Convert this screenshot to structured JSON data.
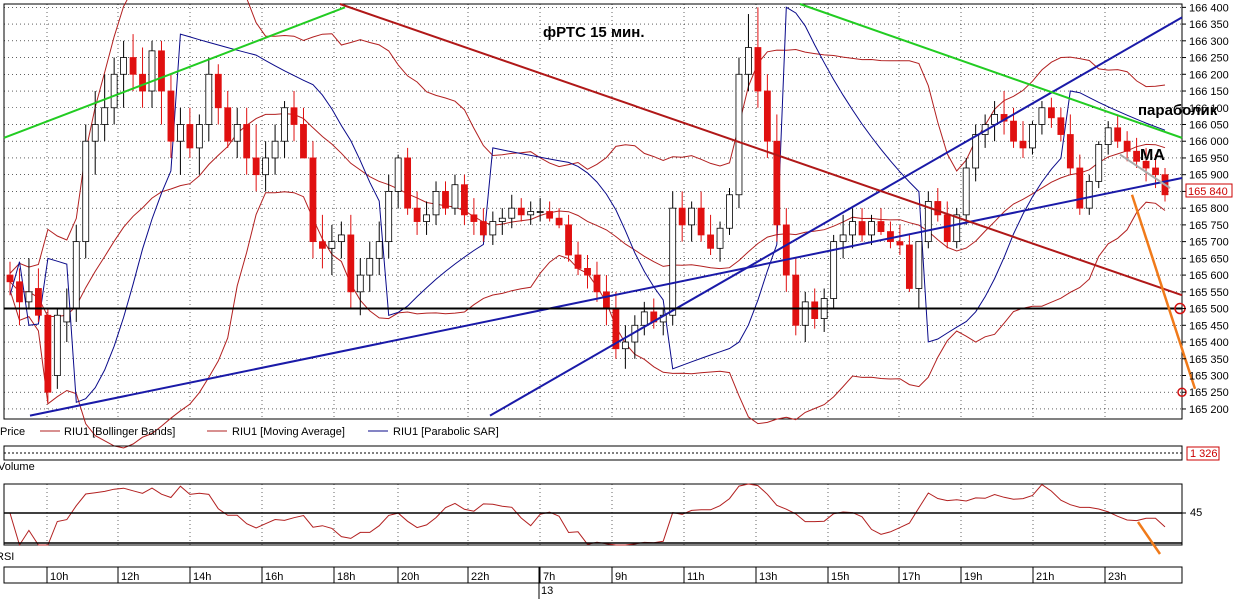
{
  "chart_data": {
    "type": "candlestick",
    "title": "фРТС   15 мин.",
    "colors": {
      "up_candle": "#ffffff",
      "down_candle": "#e01010",
      "bollinger": "#b22020",
      "moving_average": "#b22020",
      "parabolic_sar": "#0a0a8a",
      "channel": "#1a1aa8",
      "resistance_red": "#b01818",
      "green_lines": "#22cc22",
      "forecast": "#f07a1a",
      "grid": "#000000"
    },
    "price_axis": {
      "ticks": [
        166400,
        166350,
        166300,
        166250,
        166200,
        166150,
        166100,
        166050,
        166000,
        165950,
        165900,
        165850,
        165800,
        165750,
        165700,
        165650,
        165600,
        165550,
        165500,
        165450,
        165400,
        165350,
        165300,
        165250,
        165200
      ],
      "tick_labels": [
        "166 400",
        "166 350",
        "166 300",
        "166 250",
        "166 200",
        "166 150",
        "166 100",
        "166 050",
        "166 000",
        "165 950",
        "165 900",
        "165 850",
        "165 800",
        "165 750",
        "165 700",
        "165 650",
        "165 600",
        "165 550",
        "165 500",
        "165 450",
        "165 400",
        "165 350",
        "165 300",
        "165 250",
        "165 200"
      ],
      "ylim": [
        165170,
        166410
      ],
      "current_price_label": "165 840",
      "current_price": 165840
    },
    "legend": [
      {
        "label": "Price",
        "icon": "none"
      },
      {
        "label": "RIU1 [Bollinger Bands]",
        "icon": "red-line"
      },
      {
        "label": "RIU1 [Moving Average]",
        "icon": "red-line"
      },
      {
        "label": "RIU1 [Parabolic SAR]",
        "icon": "blue-line"
      }
    ],
    "annotations": [
      {
        "text": "параболик"
      },
      {
        "text": "МА"
      }
    ],
    "time_axis": {
      "labels": [
        "10h",
        "12h",
        "14h",
        "16h",
        "18h",
        "20h",
        "22h",
        "7h",
        "9h",
        "11h",
        "13h",
        "15h",
        "17h",
        "19h",
        "21h",
        "23h"
      ],
      "date_label": "13"
    },
    "volume_panel": {
      "title": "Volume",
      "value_label": "1 326"
    },
    "rsi_panel": {
      "title": "RSI",
      "level_label": "45",
      "ylim": [
        0,
        100
      ]
    },
    "candles": [
      [
        165600,
        165640,
        165540,
        165580
      ],
      [
        165580,
        165620,
        165450,
        165520
      ],
      [
        165520,
        165650,
        165500,
        165550
      ],
      [
        165560,
        165620,
        165460,
        165480
      ],
      [
        165480,
        165500,
        165220,
        165250
      ],
      [
        165300,
        165500,
        165260,
        165480
      ],
      [
        165460,
        165560,
        165400,
        165500
      ],
      [
        165500,
        165750,
        165460,
        165700
      ],
      [
        165700,
        166050,
        165650,
        166000
      ],
      [
        166000,
        166150,
        165900,
        166050
      ],
      [
        166050,
        166200,
        166000,
        166100
      ],
      [
        166100,
        166250,
        166050,
        166200
      ],
      [
        166200,
        166300,
        166100,
        166250
      ],
      [
        166250,
        166320,
        166150,
        166200
      ],
      [
        166200,
        166280,
        166100,
        166150
      ],
      [
        166150,
        166300,
        166100,
        166270
      ],
      [
        166270,
        166300,
        166050,
        166150
      ],
      [
        166150,
        166200,
        165950,
        166000
      ],
      [
        166000,
        166100,
        165900,
        166050
      ],
      [
        166050,
        166100,
        165950,
        165980
      ],
      [
        165980,
        166080,
        165900,
        166050
      ],
      [
        166050,
        166250,
        166000,
        166200
      ],
      [
        166200,
        166230,
        166050,
        166100
      ],
      [
        166100,
        166150,
        165980,
        166000
      ],
      [
        166000,
        166100,
        165950,
        166050
      ],
      [
        166050,
        166100,
        165900,
        165950
      ],
      [
        165950,
        166050,
        165850,
        165900
      ],
      [
        165900,
        166000,
        165850,
        165950
      ],
      [
        165950,
        166050,
        165900,
        166000
      ],
      [
        166000,
        166120,
        165950,
        166100
      ],
      [
        166100,
        166150,
        166000,
        166050
      ],
      [
        166050,
        166100,
        165950,
        165950
      ],
      [
        165950,
        166000,
        165650,
        165700
      ],
      [
        165700,
        165780,
        165620,
        165680
      ],
      [
        165680,
        165750,
        165600,
        165700
      ],
      [
        165700,
        165760,
        165650,
        165720
      ],
      [
        165720,
        165780,
        165500,
        165550
      ],
      [
        165550,
        165650,
        165480,
        165600
      ],
      [
        165600,
        165700,
        165550,
        165650
      ],
      [
        165650,
        165760,
        165600,
        165700
      ],
      [
        165700,
        165900,
        165650,
        165850
      ],
      [
        165850,
        165960,
        165800,
        165950
      ],
      [
        165950,
        165980,
        165780,
        165800
      ],
      [
        165800,
        165850,
        165720,
        165760
      ],
      [
        165760,
        165820,
        165720,
        165780
      ],
      [
        165780,
        165880,
        165750,
        165850
      ],
      [
        165850,
        165880,
        165780,
        165800
      ],
      [
        165800,
        165900,
        165780,
        165870
      ],
      [
        165870,
        165900,
        165750,
        165780
      ],
      [
        165780,
        165830,
        165720,
        165760
      ],
      [
        165760,
        165800,
        165700,
        165720
      ],
      [
        165720,
        165790,
        165690,
        165760
      ],
      [
        165760,
        165800,
        165720,
        165770
      ],
      [
        165770,
        165840,
        165740,
        165800
      ],
      [
        165800,
        165830,
        165760,
        165780
      ],
      [
        165780,
        165820,
        165750,
        165790
      ],
      [
        165790,
        165830,
        165760,
        165790
      ],
      [
        165790,
        165820,
        165760,
        165770
      ],
      [
        165770,
        165800,
        165740,
        165750
      ],
      [
        165750,
        165780,
        165640,
        165660
      ],
      [
        165660,
        165700,
        165600,
        165620
      ],
      [
        165620,
        165660,
        165560,
        165600
      ],
      [
        165600,
        165640,
        165520,
        165550
      ],
      [
        165550,
        165600,
        165450,
        165500
      ],
      [
        165500,
        165550,
        165350,
        165380
      ],
      [
        165380,
        165450,
        165320,
        165400
      ],
      [
        165400,
        165480,
        165350,
        165450
      ],
      [
        165450,
        165520,
        165420,
        165490
      ],
      [
        165490,
        165530,
        165440,
        165460
      ],
      [
        165460,
        165500,
        165420,
        165480
      ],
      [
        165480,
        165850,
        165450,
        165800
      ],
      [
        165800,
        165850,
        165700,
        165750
      ],
      [
        165750,
        165820,
        165700,
        165800
      ],
      [
        165800,
        165850,
        165700,
        165720
      ],
      [
        165720,
        165780,
        165660,
        165680
      ],
      [
        165680,
        165760,
        165640,
        165740
      ],
      [
        165740,
        165860,
        165720,
        165840
      ],
      [
        165840,
        166250,
        165800,
        166200
      ],
      [
        166200,
        166380,
        166150,
        166280
      ],
      [
        166280,
        166400,
        166100,
        166150
      ],
      [
        166150,
        166200,
        165950,
        166000
      ],
      [
        166000,
        166080,
        165700,
        165750
      ],
      [
        165750,
        165800,
        165550,
        165600
      ],
      [
        165600,
        165650,
        165420,
        165450
      ],
      [
        165450,
        165550,
        165400,
        165520
      ],
      [
        165520,
        165560,
        165440,
        165470
      ],
      [
        165470,
        165560,
        165430,
        165530
      ],
      [
        165530,
        165720,
        165500,
        165700
      ],
      [
        165700,
        165780,
        165650,
        165720
      ],
      [
        165720,
        165800,
        165680,
        165760
      ],
      [
        165760,
        165800,
        165700,
        165720
      ],
      [
        165720,
        165780,
        165690,
        165760
      ],
      [
        165760,
        165800,
        165720,
        165730
      ],
      [
        165730,
        165760,
        165680,
        165700
      ],
      [
        165700,
        165750,
        165660,
        165690
      ],
      [
        165690,
        165720,
        165550,
        165560
      ],
      [
        165560,
        165700,
        165500,
        165700
      ],
      [
        165700,
        165850,
        165680,
        165820
      ],
      [
        165820,
        165860,
        165760,
        165780
      ],
      [
        165780,
        165820,
        165680,
        165700
      ],
      [
        165700,
        165800,
        165680,
        165780
      ],
      [
        165780,
        165950,
        165750,
        165920
      ],
      [
        165920,
        166050,
        165880,
        166020
      ],
      [
        166020,
        166080,
        165980,
        166050
      ],
      [
        166050,
        166120,
        166000,
        166080
      ],
      [
        166080,
        166150,
        166020,
        166060
      ],
      [
        166060,
        166100,
        165980,
        166000
      ],
      [
        166000,
        166060,
        165950,
        165980
      ],
      [
        165980,
        166060,
        165960,
        166050
      ],
      [
        166050,
        166120,
        166020,
        166100
      ],
      [
        166100,
        166130,
        166040,
        166070
      ],
      [
        166070,
        166100,
        166000,
        166020
      ],
      [
        166020,
        166080,
        165900,
        165920
      ],
      [
        165920,
        165960,
        165780,
        165800
      ],
      [
        165800,
        165900,
        165780,
        165880
      ],
      [
        165880,
        166000,
        165860,
        165990
      ],
      [
        165990,
        166060,
        165960,
        166040
      ],
      [
        166040,
        166080,
        165980,
        166000
      ],
      [
        166000,
        166030,
        165940,
        165970
      ],
      [
        165970,
        166010,
        165920,
        165940
      ],
      [
        165940,
        165980,
        165880,
        165920
      ],
      [
        165920,
        165960,
        165860,
        165900
      ],
      [
        165900,
        165920,
        165820,
        165840
      ]
    ]
  }
}
